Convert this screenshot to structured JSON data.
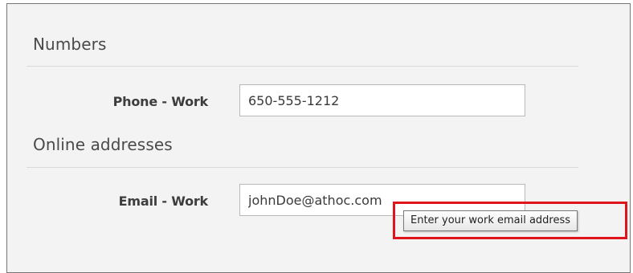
{
  "sections": {
    "numbers": {
      "title": "Numbers",
      "phone_work": {
        "label": "Phone - Work",
        "value": "650-555-1212"
      }
    },
    "online_addresses": {
      "title": "Online addresses",
      "email_work": {
        "label": "Email - Work",
        "value": "johnDoe@athoc.com"
      }
    }
  },
  "tooltip": {
    "text": "Enter your work email address"
  },
  "colors": {
    "highlight": "#e0141c",
    "panel_background": "#f3f3f3"
  }
}
